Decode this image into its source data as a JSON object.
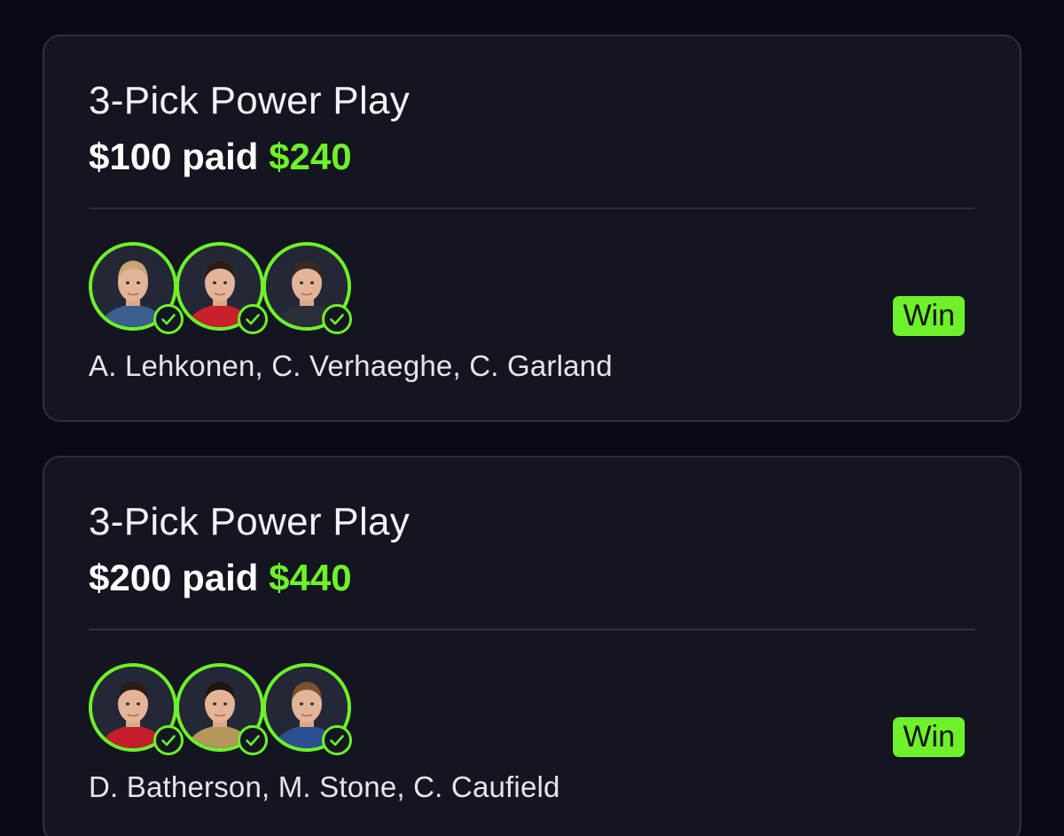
{
  "theme": {
    "background": "#080a14",
    "card_background": "#131520",
    "card_border": "#2d303c",
    "accent_green": "#6ef12a",
    "text_primary": "#ffffff"
  },
  "entries": [
    {
      "entry_type": "3-Pick Power Play",
      "stake": "$100 paid",
      "payout": "$240",
      "status": "Win",
      "players": "A. Lehkonen, C. Verhaeghe, C. Garland",
      "avatars": [
        {
          "icon": "player-headshot-icon",
          "jersey_color": "#3a5f8f",
          "hair_color": "#c9a772"
        },
        {
          "icon": "player-headshot-icon",
          "jersey_color": "#c9202a",
          "hair_color": "#2a1d14"
        },
        {
          "icon": "player-headshot-icon",
          "jersey_color": "#2b2f3a",
          "hair_color": "#3a2a20"
        }
      ]
    },
    {
      "entry_type": "3-Pick Power Play",
      "stake": "$200 paid",
      "payout": "$440",
      "status": "Win",
      "players": "D. Batherson, M. Stone, C. Caufield",
      "avatars": [
        {
          "icon": "player-headshot-icon",
          "jersey_color": "#c41e2a",
          "hair_color": "#2b1c14"
        },
        {
          "icon": "player-headshot-icon",
          "jersey_color": "#b4975a",
          "hair_color": "#1d1510"
        },
        {
          "icon": "player-headshot-icon",
          "jersey_color": "#2c4f8f",
          "hair_color": "#7a5230"
        }
      ]
    }
  ]
}
